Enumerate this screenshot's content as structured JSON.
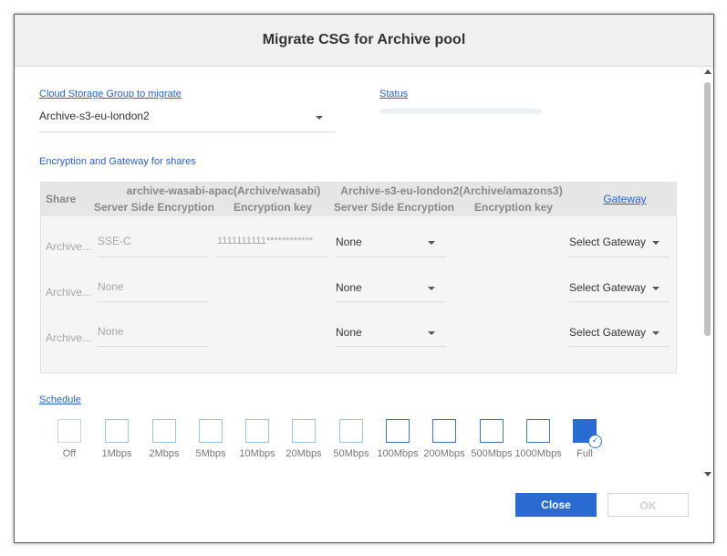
{
  "dialog": {
    "title": "Migrate CSG for Archive pool"
  },
  "csg": {
    "label": "Cloud Storage Group to migrate",
    "value": "Archive-s3-eu-london2"
  },
  "status": {
    "label": "Status"
  },
  "encryption": {
    "label": "Encryption and Gateway for shares"
  },
  "table": {
    "share_header": "Share",
    "source_group": "archive-wasabi-apac(Archive/wasabi)",
    "target_group": "Archive-s3-eu-london2(Archive/amazons3)",
    "sse_header": "Server Side Encryption",
    "key_header": "Encryption key",
    "gateway_header": "Gateway",
    "rows": [
      {
        "share": "Archive...",
        "src_sse": "SSE-C",
        "src_key": "1111111111************",
        "dst_sse": "None",
        "gateway": "Select Gateway"
      },
      {
        "share": "Archive...",
        "src_sse": "None",
        "src_key": "",
        "dst_sse": "None",
        "gateway": "Select Gateway"
      },
      {
        "share": "Archive...",
        "src_sse": "None",
        "src_key": "",
        "dst_sse": "None",
        "gateway": "Select Gateway"
      }
    ]
  },
  "schedule": {
    "label": "Schedule",
    "options": [
      "Off",
      "1Mbps",
      "2Mbps",
      "5Mbps",
      "10Mbps",
      "20Mbps",
      "50Mbps",
      "100Mbps",
      "200Mbps",
      "500Mbps",
      "1000Mbps",
      "Full"
    ],
    "selected": "Full",
    "accent": "#2a6bd1"
  },
  "buttons": {
    "close": "Close",
    "ok": "OK"
  }
}
